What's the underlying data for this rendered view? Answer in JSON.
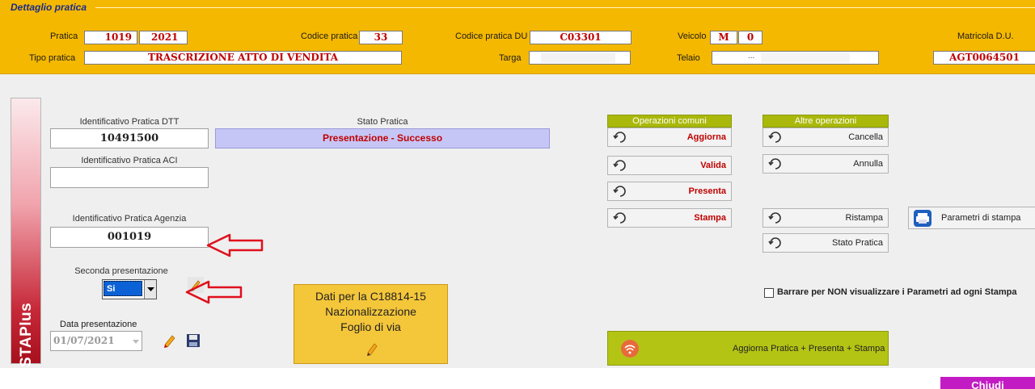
{
  "header": {
    "title": "Dettaglio pratica",
    "pratica_label": "Pratica",
    "pratica_num": "1019",
    "pratica_year": "2021",
    "codice_pratica_label": "Codice pratica",
    "codice_pratica_value": "33",
    "codice_du_label": "Codice pratica DU",
    "codice_du_value": "C03301",
    "veicolo_label": "Veicolo",
    "veicolo_type": "M",
    "veicolo_num": "0",
    "matricola_label": "Matricola D.U.",
    "tipo_pratica_label": "Tipo pratica",
    "tipo_pratica_value": "TRASCRIZIONE ATTO DI VENDITA",
    "targa_label": "Targa",
    "telaio_label": "Telaio",
    "telaio_partial": "...",
    "matricola_value": "AGT0064501"
  },
  "sidebar": {
    "label": "STAPlus"
  },
  "form": {
    "id_dtt_label": "Identificativo Pratica DTT",
    "id_dtt_value": "10491500",
    "stato_label": "Stato Pratica",
    "stato_value": "Presentazione - Successo",
    "id_aci_label": "Identificativo Pratica ACI",
    "id_aci_value": "",
    "id_agenzia_label": "Identificativo Pratica Agenzia",
    "id_agenzia_value": "001019",
    "seconda_label": "Seconda presentazione",
    "seconda_value": "Si",
    "data_label": "Data presentazione",
    "data_value": "01/07/2021"
  },
  "info_button": {
    "line1": "Dati per la C18814-15",
    "line2": "Nazionalizzazione",
    "line3": "Foglio di via"
  },
  "operazioni_comuni": {
    "title": "Operazioni comuni",
    "aggiorna": "Aggiorna",
    "valida": "Valida",
    "presenta": "Presenta",
    "stampa": "Stampa"
  },
  "altre_operazioni": {
    "title": "Altre operazioni",
    "cancella": "Cancella",
    "annulla": "Annulla",
    "ristampa": "Ristampa",
    "stato_pratica": "Stato Pratica"
  },
  "parametri_stampa": "Parametri di stampa",
  "checkbox_label": "Barrare per NON visualizzare i Parametri ad ogni Stampa",
  "big_action": "Aggiorna Pratica + Presenta + Stampa",
  "chiudi": "Chiudi",
  "colors": {
    "header_bg": "#f5b800",
    "accent_red": "#c00000",
    "status_bg": "#c6c6f6",
    "section_green": "#a9b80a",
    "chiudi_bg": "#c21bc4",
    "annotation_arrow": "#e0101c"
  },
  "icons": [
    "reload-icon",
    "printer-icon",
    "wifi-icon",
    "pencil-icon",
    "save-icon",
    "dropdown-arrow-icon",
    "annotation-arrow-icon"
  ]
}
